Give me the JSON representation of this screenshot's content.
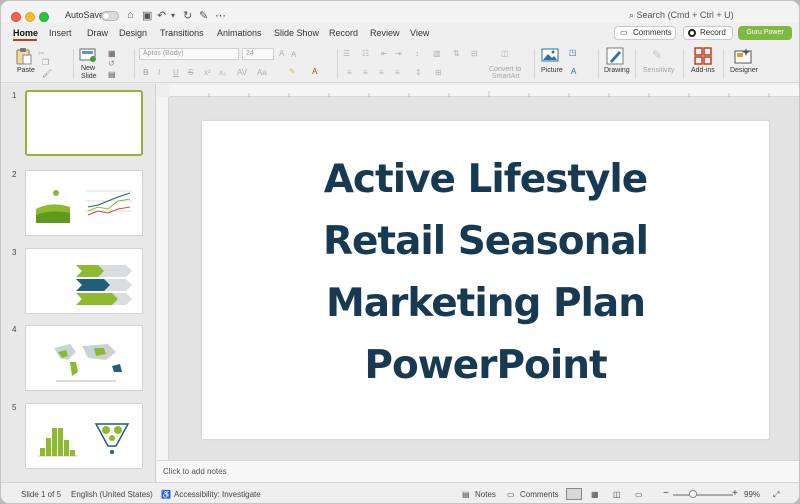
{
  "titlebar": {
    "autosave_label": "AutoSave",
    "search_placeholder": "Search (Cmd + Ctrl + U)"
  },
  "tabs": [
    {
      "label": "Home"
    },
    {
      "label": "Insert"
    },
    {
      "label": "Draw"
    },
    {
      "label": "Design"
    },
    {
      "label": "Transitions"
    },
    {
      "label": "Animations"
    },
    {
      "label": "Slide Show"
    },
    {
      "label": "Record"
    },
    {
      "label": "Review"
    },
    {
      "label": "View"
    }
  ],
  "header_buttons": {
    "comments": "Comments",
    "record": "Record",
    "guru": "Guru Power"
  },
  "ribbon": {
    "paste": "Paste",
    "new_slide_1": "New",
    "new_slide_2": "Slide",
    "font_name": "Aptos (Body)",
    "font_size": "24",
    "convert_1": "Convert to",
    "convert_2": "SmartArt",
    "picture": "Picture",
    "drawing": "Drawing",
    "sensitivity": "Sensitivity",
    "addins": "Add-ins",
    "designer": "Designer"
  },
  "thumbnails": [
    {
      "num": "1"
    },
    {
      "num": "2"
    },
    {
      "num": "3"
    },
    {
      "num": "4"
    },
    {
      "num": "5"
    }
  ],
  "slide": {
    "title_lines": [
      "Active Lifestyle",
      "Retail Seasonal",
      "Marketing Plan",
      "PowerPoint"
    ]
  },
  "notes_placeholder": "Click to add notes",
  "status": {
    "slide_count": "Slide 1 of 5",
    "language": "English (United States)",
    "accessibility": "Accessibility: Investigate",
    "notes": "Notes",
    "comments": "Comments",
    "zoom": "99%"
  },
  "colors": {
    "title": "#173a52",
    "accent_green": "#7fb843",
    "accent_blue": "#1f5f7a",
    "tab_underline": "#c43e1c"
  }
}
